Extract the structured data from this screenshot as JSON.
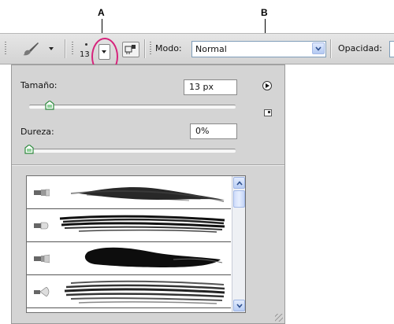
{
  "callouts": {
    "a_label": "A",
    "b_label": "B"
  },
  "options_bar": {
    "tool_icon": "brush-tool-icon",
    "brush_size_preview": "13",
    "brush_picker_icon": "chevron-down-icon",
    "airbrush_icon": "airbrush-icon",
    "mode_label": "Modo:",
    "mode_value": "Normal",
    "opacity_label": "Opacidad:"
  },
  "brush_panel": {
    "size_label": "Tamaño:",
    "size_value": "13 px",
    "size_level": 0.1,
    "hardness_label": "Dureza:",
    "hardness_value": "0%",
    "hardness_level": 0,
    "menu_icon": "panel-menu-icon",
    "new_preset_icon": "new-preset-icon",
    "presets": [
      {
        "name": "brush-preset-flat-point"
      },
      {
        "name": "brush-preset-flat-blunt"
      },
      {
        "name": "brush-preset-flat-curve"
      },
      {
        "name": "brush-preset-fan"
      }
    ]
  },
  "colors": {
    "highlight": "#d6247c",
    "panel_bg": "#d4d4d4",
    "toolbar_bg": "#dcdcdc",
    "scroll_accent": "#b8cdf4"
  }
}
